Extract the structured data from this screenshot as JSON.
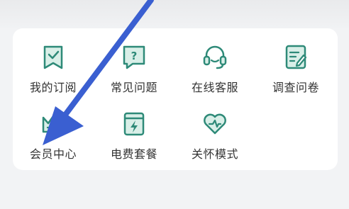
{
  "colors": {
    "icon_green": "#2e8a78",
    "icon_fill": "#d9efe8",
    "arrow_blue": "#3a5fd1"
  },
  "services": [
    {
      "label": "我的订阅",
      "icon": "bookmark-check-icon"
    },
    {
      "label": "常见问题",
      "icon": "question-chat-icon"
    },
    {
      "label": "在线客服",
      "icon": "headset-icon"
    },
    {
      "label": "调查问卷",
      "icon": "survey-edit-icon"
    },
    {
      "label": "会员中心",
      "icon": "crown-icon"
    },
    {
      "label": "电费套餐",
      "icon": "power-package-icon"
    },
    {
      "label": "关怀模式",
      "icon": "heart-care-icon"
    }
  ]
}
